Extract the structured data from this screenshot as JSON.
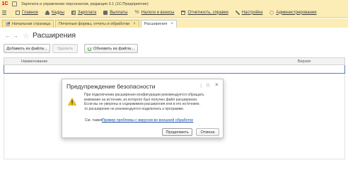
{
  "titlebar": {
    "logo": "1С",
    "title": "Зарплата и управление персоналом, редакция 3.1  (1С:Предприятие)"
  },
  "menu": [
    {
      "label": "Главное",
      "icon": "list-icon"
    },
    {
      "label": "Кадры",
      "icon": "people-icon"
    },
    {
      "label": "Зарплата",
      "icon": "calculator-icon"
    },
    {
      "label": "Выплаты",
      "icon": "cash-icon"
    },
    {
      "label": "Налоги и взносы",
      "icon": "percent-icon"
    },
    {
      "label": "Отчетность, справки",
      "icon": "report-icon"
    },
    {
      "label": "Настройка",
      "icon": "wrench-icon"
    },
    {
      "label": "Администрирование",
      "icon": "gear-icon"
    }
  ],
  "tabs": [
    {
      "label": "Начальная страница"
    },
    {
      "label": "Печатные формы, отчеты и обработки"
    },
    {
      "label": "Расширения"
    }
  ],
  "form": {
    "title": "Расширения",
    "back": "←",
    "forward": "→",
    "star": "☆"
  },
  "toolbar": {
    "add_from_file": "Добавить из файла...",
    "delete": "Удалить",
    "update_from_file": "Обновить из файла..."
  },
  "table": {
    "columns": [
      "Наименование",
      "Версия"
    ]
  },
  "dialog": {
    "title": "Предупреждение безопасности",
    "menu_glyph": "⋮",
    "maximize_glyph": "□",
    "close_glyph": "×",
    "message_lines": [
      "При подключении расширения конфигурации рекомендуется обращать",
      "внимание на источник, из которого был получен файл расширения.",
      "Если вы не уверены в содержимом расширения или в его источнике,",
      "то расширение не рекомендуется подключать к программе."
    ],
    "see_also": "См. также:",
    "link": "Пример проблемы с вирусом во внешней обработке",
    "continue_label": "Продолжить",
    "cancel_label": "Отмена"
  },
  "colors": {
    "accent_bar": "#fbedb5",
    "link": "#1a4fa3",
    "warning": "#f0c419"
  }
}
